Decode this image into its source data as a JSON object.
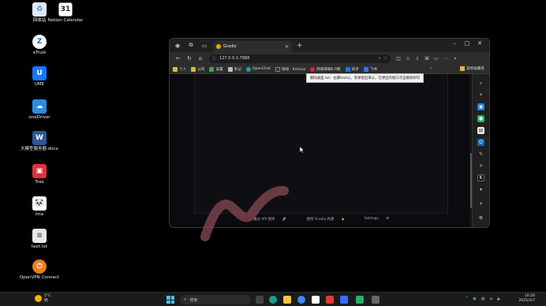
{
  "desktop": {
    "icons": [
      {
        "label": "回收站",
        "icon": "recycle-bin-icon",
        "color": "#3a7bd5"
      },
      {
        "label": "Notion Calendar",
        "icon": "calendar-icon",
        "color": "#ffffff"
      },
      {
        "label": "aTrust",
        "icon": "atrust-icon",
        "color": "#1a6fd8"
      },
      {
        "label": "UME",
        "icon": "ume-icon",
        "color": "#1677ff"
      },
      {
        "label": "oneDriver",
        "icon": "onedrive-folder-icon",
        "color": "#2b8de3"
      },
      {
        "label": "大模型服务器.docx",
        "icon": "word-doc-icon",
        "color": "#2b579a"
      },
      {
        "label": "Trae",
        "icon": "trae-icon",
        "color": "#e0303e"
      },
      {
        "label": "ima",
        "icon": "ima-icon",
        "color": "#ffffff"
      },
      {
        "label": "text.txt",
        "icon": "text-file-icon",
        "color": "#e8e8e8"
      },
      {
        "label": "OpenVPN Connect",
        "icon": "openvpn-icon",
        "color": "#ea7e20"
      }
    ]
  },
  "browser": {
    "tab_title": "Gradio",
    "url": "127.0.0.1:7888",
    "bookmarks": [
      {
        "label": "个人",
        "color": "#e0b341"
      },
      {
        "label": "公司",
        "color": "#e0b341"
      },
      {
        "label": "设置",
        "color": "#39a845"
      },
      {
        "label": "杂记",
        "color": "#bbbbbb"
      },
      {
        "label": "OpenChat",
        "color": "#18a0b8"
      },
      {
        "label": "张翊 - KimiLai",
        "color": "#333333"
      },
      {
        "label": "网易邮箱6.0版",
        "color": "#d9232d"
      },
      {
        "label": "知乎",
        "color": "#1772f6"
      },
      {
        "label": "飞书",
        "color": "#3370ff"
      }
    ],
    "bookmarks_right": "其他收藏夹",
    "tooltip": "删除桌面 txt：右键text以，等弹窗出来以，在弹出的窗口点击删除即可"
  },
  "gradio": {
    "footer": {
      "api": "通过 API 使用",
      "built": "使用 Gradio 构建",
      "settings": "Settings"
    }
  },
  "taskbar": {
    "weather_temp": "5°C",
    "weather_desc": "阴",
    "search_placeholder": "搜索",
    "ime": "中",
    "time": "10:26",
    "date": "2025/3/7"
  }
}
